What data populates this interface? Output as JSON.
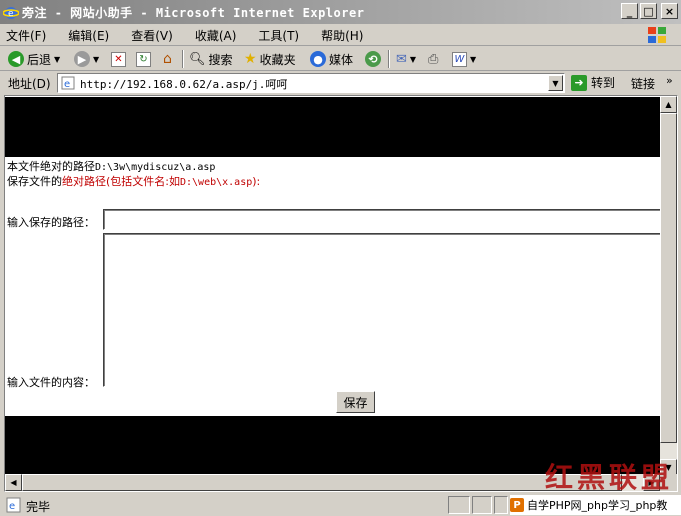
{
  "window": {
    "title": "旁注 - 网站小助手 - Microsoft Internet Explorer",
    "buttons": {
      "minimize": "_",
      "maximize": "□",
      "close": "×"
    }
  },
  "menu": [
    {
      "label": "文件(F)"
    },
    {
      "label": "编辑(E)"
    },
    {
      "label": "查看(V)"
    },
    {
      "label": "收藏(A)"
    },
    {
      "label": "工具(T)"
    },
    {
      "label": "帮助(H)"
    }
  ],
  "toolbar": {
    "back": "后退",
    "search": "搜索",
    "favorites": "收藏夹",
    "media": "媒体"
  },
  "address": {
    "label": "地址(D)",
    "url": "http://192.168.0.62/a.asp/j.呵呵",
    "go": "转到",
    "links": "链接",
    "links_more": "»"
  },
  "page": {
    "path_label": "本文件绝对的路径",
    "path_value": "D:\\3w\\mydiscuz\\a.asp",
    "save_prefix": "保存文件的",
    "save_red": "绝对路径(包括文件名:如",
    "save_example": "D:\\web\\x.asp",
    "save_suffix": "):",
    "path_input_label": "输入保存的路径：",
    "path_input_value": "",
    "content_label": "输入文件的内容：",
    "content_value": "",
    "save_button": "保存"
  },
  "watermark": "红黑联盟",
  "status": {
    "text": "完毕",
    "ad_text": "自学PHP网_php学习_php教"
  },
  "colors": {
    "chrome": "#d4d0c8",
    "page_black": "#000000",
    "red_text": "#c00000",
    "go_green": "#2a9a2a"
  }
}
